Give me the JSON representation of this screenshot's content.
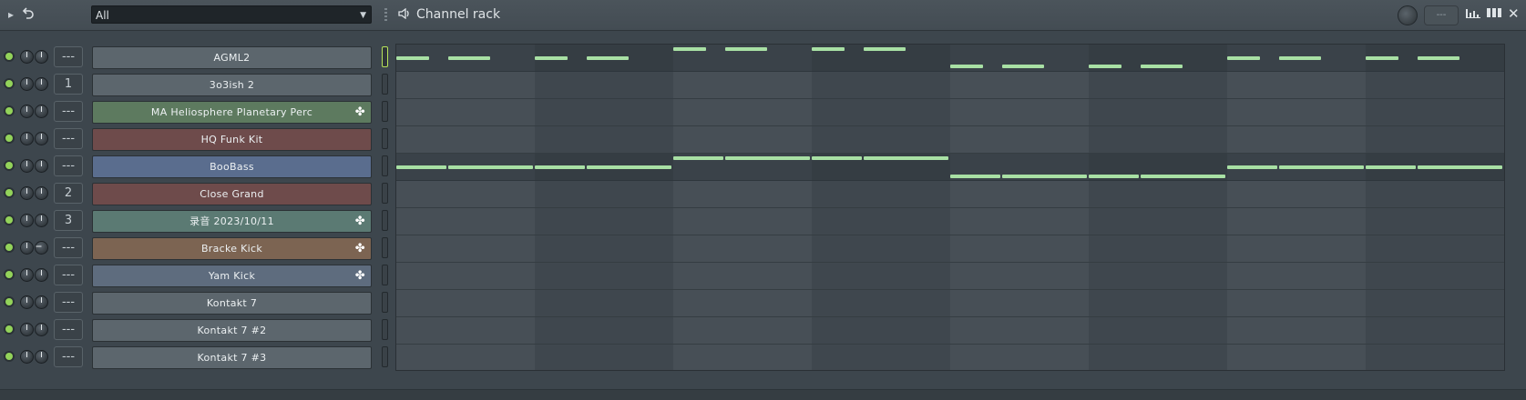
{
  "toolbar": {
    "filter_value": "All",
    "title": "Channel rack",
    "swing_placeholder": "---"
  },
  "channels": [
    {
      "route": "---",
      "name": "AGML2",
      "color": "#5c666d",
      "wave": false,
      "selected": true,
      "pan": false
    },
    {
      "route": "1",
      "name": "3o3ish 2",
      "color": "#5c666d",
      "wave": false,
      "selected": false,
      "pan": false
    },
    {
      "route": "---",
      "name": "MA Heliosphere Planetary Perc",
      "color": "#5d7a5f",
      "wave": true,
      "selected": false,
      "pan": false
    },
    {
      "route": "---",
      "name": "HQ Funk Kit",
      "color": "#6e4b4b",
      "wave": false,
      "selected": false,
      "pan": false
    },
    {
      "route": "---",
      "name": "BooBass",
      "color": "#5a6d8e",
      "wave": false,
      "selected": false,
      "pan": false
    },
    {
      "route": "2",
      "name": "Close Grand",
      "color": "#6e4b4b",
      "wave": false,
      "selected": false,
      "pan": false
    },
    {
      "route": "3",
      "name": "录音 2023/10/11",
      "color": "#5b7a73",
      "wave": true,
      "selected": false,
      "pan": false
    },
    {
      "route": "---",
      "name": "Bracke Kick",
      "color": "#7c6452",
      "wave": true,
      "selected": false,
      "pan": true
    },
    {
      "route": "---",
      "name": "Yam Kick",
      "color": "#5e6c7e",
      "wave": true,
      "selected": false,
      "pan": false
    },
    {
      "route": "---",
      "name": "Kontakt 7",
      "color": "#5c666d",
      "wave": false,
      "selected": false,
      "pan": false
    },
    {
      "route": "---",
      "name": "Kontakt 7 #2",
      "color": "#5c666d",
      "wave": false,
      "selected": false,
      "pan": false
    },
    {
      "route": "---",
      "name": "Kontakt 7 #3",
      "color": "#5c666d",
      "wave": false,
      "selected": false,
      "pan": false
    }
  ],
  "piano_roll_previews": [
    {
      "channel_index": 0,
      "notes": [
        {
          "start": 0,
          "len": 0.25,
          "level": 0.5
        },
        {
          "start": 0.375,
          "len": 0.3125,
          "level": 0.5
        },
        {
          "start": 1.0,
          "len": 0.25,
          "level": 0.5
        },
        {
          "start": 1.375,
          "len": 0.3125,
          "level": 0.5
        },
        {
          "start": 2.0,
          "len": 0.25,
          "level": 0.95
        },
        {
          "start": 2.375,
          "len": 0.3125,
          "level": 0.95
        },
        {
          "start": 3.0,
          "len": 0.25,
          "level": 0.95
        },
        {
          "start": 3.375,
          "len": 0.3125,
          "level": 0.95
        },
        {
          "start": 4.0,
          "len": 0.25,
          "level": 0.1
        },
        {
          "start": 4.375,
          "len": 0.3125,
          "level": 0.1
        },
        {
          "start": 5.0,
          "len": 0.25,
          "level": 0.1
        },
        {
          "start": 5.375,
          "len": 0.3125,
          "level": 0.1
        },
        {
          "start": 6.0,
          "len": 0.25,
          "level": 0.5
        },
        {
          "start": 6.375,
          "len": 0.3125,
          "level": 0.5
        },
        {
          "start": 7.0,
          "len": 0.25,
          "level": 0.5
        },
        {
          "start": 7.375,
          "len": 0.3125,
          "level": 0.5
        }
      ]
    },
    {
      "channel_index": 4,
      "notes": [
        {
          "start": 0,
          "len": 0.375,
          "level": 0.5
        },
        {
          "start": 0.375,
          "len": 0.625,
          "level": 0.5
        },
        {
          "start": 1.0,
          "len": 0.375,
          "level": 0.5
        },
        {
          "start": 1.375,
          "len": 0.625,
          "level": 0.5
        },
        {
          "start": 2.0,
          "len": 0.375,
          "level": 0.95
        },
        {
          "start": 2.375,
          "len": 0.625,
          "level": 0.95
        },
        {
          "start": 3.0,
          "len": 0.375,
          "level": 0.95
        },
        {
          "start": 3.375,
          "len": 0.625,
          "level": 0.95
        },
        {
          "start": 4.0,
          "len": 0.375,
          "level": 0.05
        },
        {
          "start": 4.375,
          "len": 0.625,
          "level": 0.05
        },
        {
          "start": 5.0,
          "len": 0.375,
          "level": 0.05
        },
        {
          "start": 5.375,
          "len": 0.625,
          "level": 0.05
        },
        {
          "start": 6.0,
          "len": 0.375,
          "level": 0.5
        },
        {
          "start": 6.375,
          "len": 0.625,
          "level": 0.5
        },
        {
          "start": 7.0,
          "len": 0.375,
          "level": 0.5
        },
        {
          "start": 7.375,
          "len": 0.625,
          "level": 0.5
        }
      ]
    }
  ],
  "colors": {
    "led_on": "#93d35a",
    "note": "#a8e0a4",
    "selected_outline": "#b7e35a"
  },
  "icons": {
    "play": "play-icon",
    "undo": "undo-icon",
    "speaker": "speaker-icon",
    "wave": "waveform-icon",
    "close": "close-icon",
    "graph": "graph-icon",
    "columns": "columns-icon"
  }
}
